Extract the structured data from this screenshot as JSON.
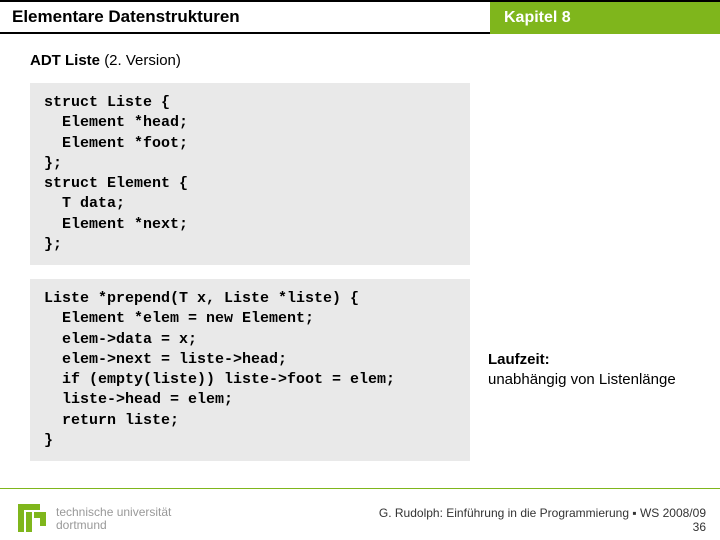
{
  "header": {
    "left": "Elementare Datenstrukturen",
    "right": "Kapitel 8"
  },
  "subtitle_bold": "ADT Liste ",
  "subtitle_light": "(2. Version)",
  "code1": "struct Liste {\n  Element *head;\n  Element *foot;\n};\nstruct Element {\n  T data;\n  Element *next;\n};",
  "code2": "Liste *prepend(T x, Liste *liste) {\n  Element *elem = new Element;\n  elem->data = x;\n  elem->next = liste->head;\n  if (empty(liste)) liste->foot = elem;\n  liste->head = elem;\n  return liste;\n}",
  "runtime_bold": "Laufzeit:",
  "runtime_text": "unabhängig von Listenlänge",
  "logo_line1": "technische universität",
  "logo_line2": "dortmund",
  "credit_line": "G. Rudolph: Einführung in die Programmierung ▪ WS 2008/09",
  "credit_page": "36"
}
